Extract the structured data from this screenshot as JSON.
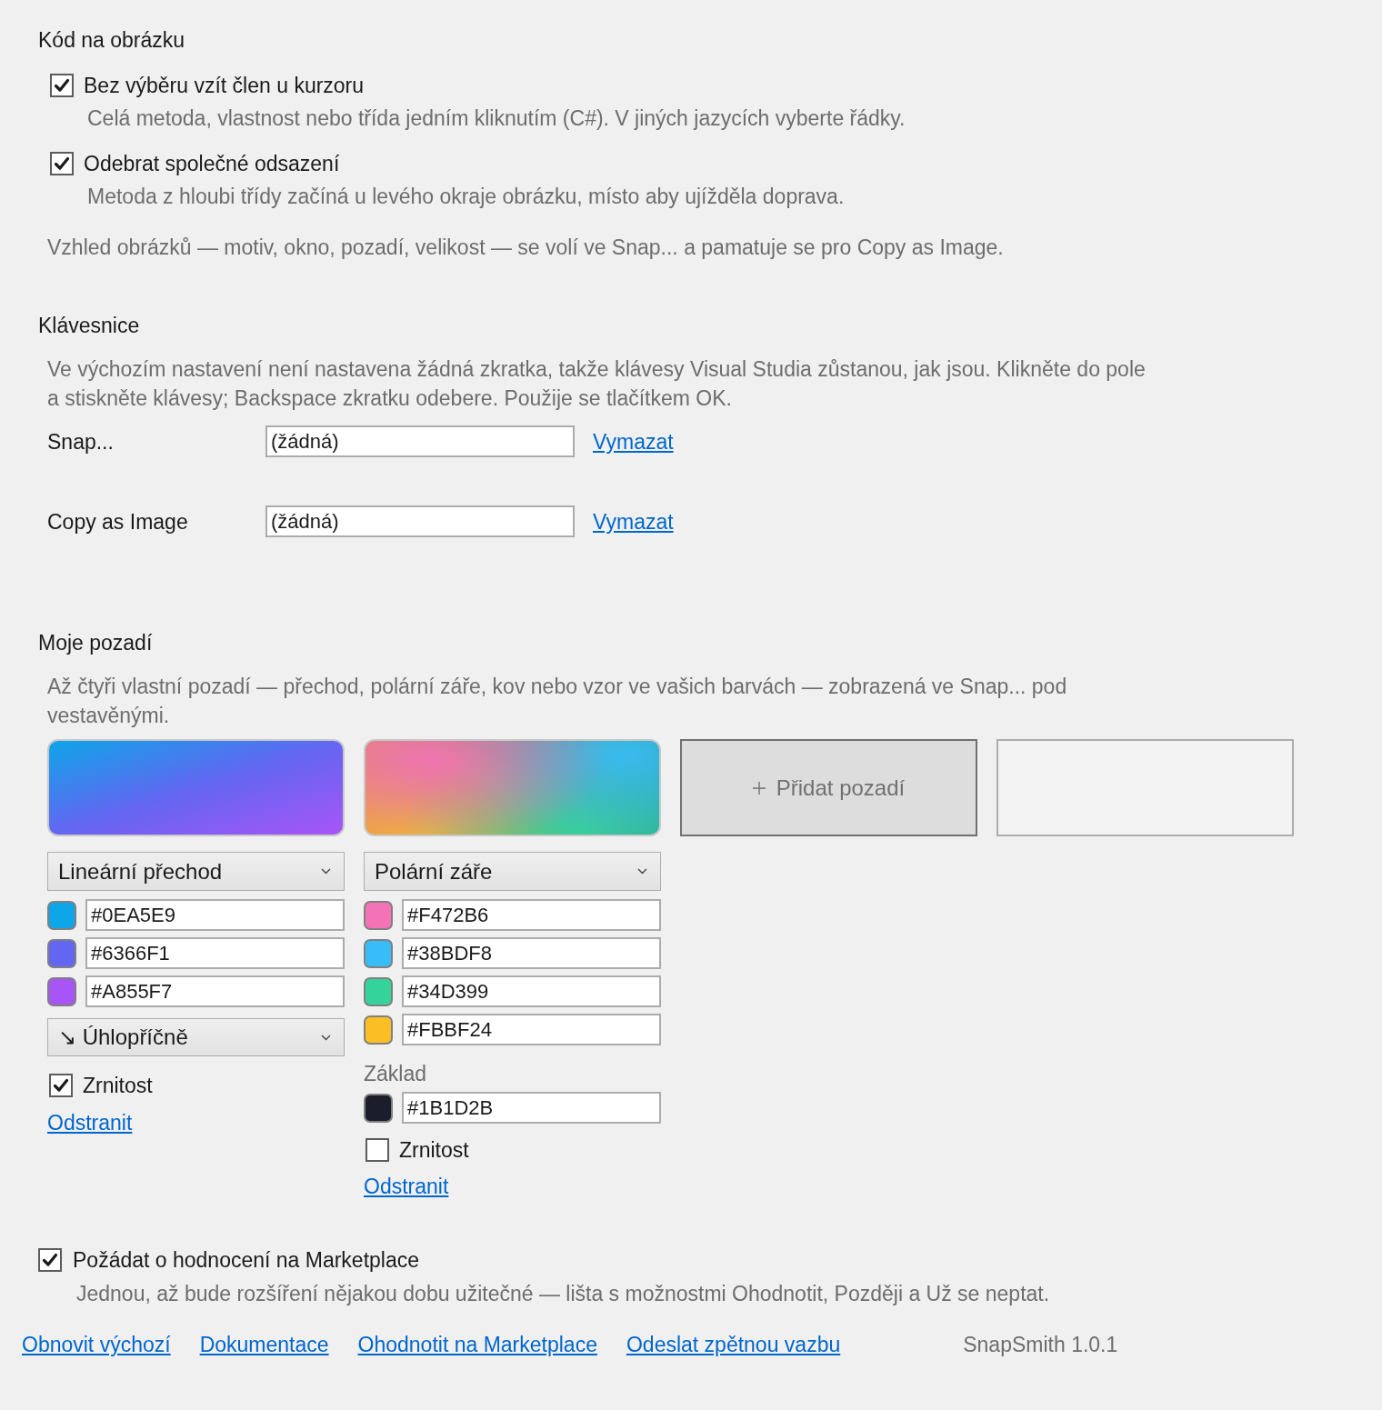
{
  "code_section": {
    "title": "Kód na obrázku",
    "options": [
      {
        "label": "Bez výběru vzít člen u kurzoru",
        "checked": true,
        "description": "Celá metoda, vlastnost nebo třída jedním kliknutím (C#). V jiných jazycích vyberte řádky."
      },
      {
        "label": "Odebrat společné odsazení",
        "checked": true,
        "description": "Metoda z hloubi třídy začíná u levého okraje obrázku, místo aby ujížděla doprava."
      }
    ],
    "note": "Vzhled obrázků — motiv, okno, pozadí, velikost — se volí ve Snap... a pamatuje se pro Copy as Image."
  },
  "keyboard_section": {
    "title": "Klávesnice",
    "description": "Ve výchozím nastavení není nastavena žádná zkratka, takže klávesy Visual Studia zůstanou, jak jsou. Klikněte do pole a stiskněte klávesy; Backspace zkratku odebere. Použije se tlačítkem OK.",
    "shortcuts": [
      {
        "label": "Snap...",
        "value": "(žádná)",
        "clear_link": "Vymazat"
      },
      {
        "label": "Copy as Image",
        "value": "(žádná)",
        "clear_link": "Vymazat"
      }
    ]
  },
  "backgrounds_section": {
    "title": "Moje pozadí",
    "description": "Až čtyři vlastní pozadí — přechod, polární záře, kov nebo vzor ve vašich barvách — zobrazená ve Snap... pod vestavěnými.",
    "slots": [
      {
        "kind": "linear",
        "type": "Lineární přechod",
        "colors": [
          {
            "value": "#0EA5E9",
            "color": "#0ea5e9"
          },
          {
            "value": "#6366F1",
            "color": "#6366f1"
          },
          {
            "value": "#A855F7",
            "color": "#a855f7"
          }
        ],
        "direction": "↘ Úhlopříčně",
        "grain": {
          "label": "Zrnitost",
          "checked": true
        },
        "remove_link": "Odstranit"
      },
      {
        "kind": "aurora",
        "type": "Polární záře",
        "colors": [
          {
            "value": "#F472B6",
            "color": "#f472b6"
          },
          {
            "value": "#38BDF8",
            "color": "#38bdf8"
          },
          {
            "value": "#34D399",
            "color": "#34d399"
          },
          {
            "value": "#FBBF24",
            "color": "#fbbf24"
          }
        ],
        "base_label": "Základ",
        "base": {
          "value": "#1B1D2B",
          "color": "#1b1d2b"
        },
        "grain": {
          "label": "Zrnitost",
          "checked": false
        },
        "remove_link": "Odstranit"
      },
      {
        "kind": "add",
        "label": "Přidat pozadí"
      },
      {
        "kind": "empty"
      }
    ]
  },
  "rating": {
    "label": "Požádat o hodnocení na Marketplace",
    "checked": true,
    "description": "Jednou, až bude rozšíření nějakou dobu užitečné — lišta s možnostmi Ohodnotit, Později a Už se neptat."
  },
  "footer": {
    "links": [
      "Obnovit výchozí",
      "Dokumentace",
      "Ohodnotit na Marketplace",
      "Odeslat zpětnou vazbu"
    ],
    "version": "SnapSmith 1.0.1"
  }
}
